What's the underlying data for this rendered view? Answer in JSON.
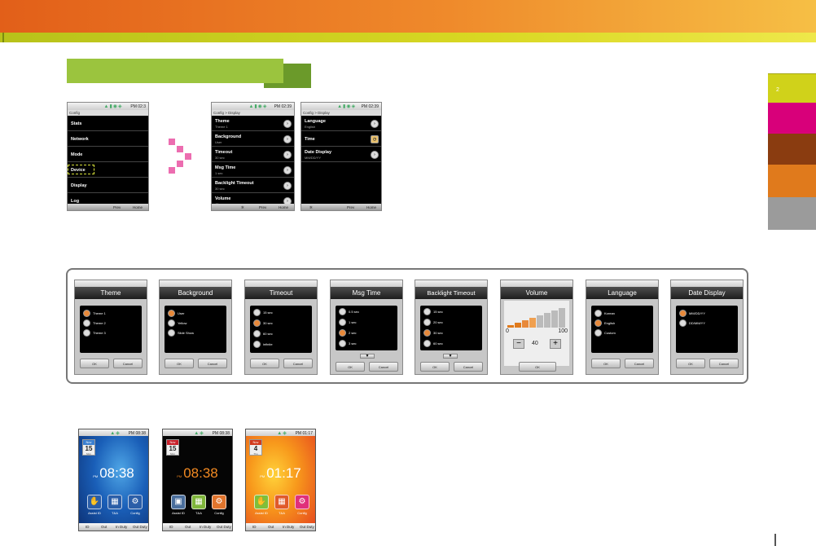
{
  "side_tab_label": "2",
  "colors": {
    "header_orange": "#e25f19",
    "header_yellow": "#d9d823",
    "section_green": "#9bc43e",
    "side_tabs": [
      "#d0d21a",
      "#d8007a",
      "#8a3c10",
      "#e07a1c",
      "#9b9b9b"
    ],
    "arrow_pink": "#ec6db0"
  },
  "phone_status_time": [
    "PM 02:3",
    "PM 02:39",
    "PM 02:39"
  ],
  "screen_config": {
    "crumb": "Config",
    "items": [
      "Stats",
      "Network",
      "Mode",
      "Device",
      "Display",
      "Log"
    ],
    "bottom": [
      "Prev",
      "Home"
    ]
  },
  "screen_display1": {
    "crumb": "Config > Display",
    "items": [
      {
        "label": "Theme",
        "sub": "Theme 1"
      },
      {
        "label": "Background",
        "sub": "User"
      },
      {
        "label": "Timeout",
        "sub": "30 sec"
      },
      {
        "label": "Msg Time",
        "sub": "1 sec"
      },
      {
        "label": "Backlight Timeout",
        "sub": "30 sec"
      },
      {
        "label": "Volume",
        "sub": "40"
      }
    ],
    "bottom": [
      "Prev",
      "Home"
    ]
  },
  "screen_display2": {
    "crumb": "Config > Display",
    "items": [
      {
        "label": "Language",
        "sub": "English"
      },
      {
        "label": "Time",
        "sub": ""
      },
      {
        "label": "Date Display",
        "sub": "MM/DD/YY"
      }
    ],
    "bottom": [
      "Prev",
      "Home"
    ]
  },
  "dialogs": [
    {
      "title": "Theme",
      "options": [
        "Theme 1",
        "Theme 2",
        "Theme 3"
      ],
      "selected": 0,
      "ok": "OK",
      "cancel": "Cancel"
    },
    {
      "title": "Background",
      "options": [
        "User",
        "Yellow",
        "Slide Show"
      ],
      "selected": 0,
      "ok": "OK",
      "cancel": "Cancel"
    },
    {
      "title": "Timeout",
      "options": [
        "15 sec",
        "30 sec",
        "60 sec",
        "infinite"
      ],
      "selected": 1,
      "ok": "OK",
      "cancel": "Cancel"
    },
    {
      "title": "Msg Time",
      "options": [
        "0.5 sec",
        "1 sec",
        "2 sec",
        "3 sec"
      ],
      "selected": 2,
      "ok": "OK",
      "cancel": "Cancel"
    },
    {
      "title": "Backlight Timeout",
      "options": [
        "15 sec",
        "20 sec",
        "30 sec",
        "60 sec"
      ],
      "selected": 2,
      "ok": "OK",
      "cancel": "Cancel"
    },
    {
      "title": "Volume",
      "min": "0",
      "max": "100",
      "value": "40",
      "ok": "OK"
    },
    {
      "title": "Language",
      "options": [
        "Korean",
        "English",
        "Custom"
      ],
      "selected": 1,
      "ok": "OK",
      "cancel": "Cancel"
    },
    {
      "title": "Date Display",
      "options": [
        "MM/DD/YY",
        "DD/MM/YY"
      ],
      "selected": 0,
      "ok": "OK",
      "cancel": "Cancel"
    }
  ],
  "home_screens": [
    {
      "status_time": "PM 08:38",
      "month": "Nov",
      "day": "15",
      "day_sub": "Mon",
      "ampm": "PM",
      "time": "08:38",
      "apps": [
        "Assist ID",
        "T&A",
        "Config"
      ],
      "bottom": [
        "ID",
        "Out",
        "In Duty",
        "Out Duty"
      ]
    },
    {
      "status_time": "PM 08:38",
      "month": "Nov",
      "day": "15",
      "day_sub": "Mon",
      "ampm": "PM",
      "time": "08:38",
      "apps": [
        "Assist ID",
        "T&A",
        "Config"
      ],
      "bottom": [
        "ID",
        "Out",
        "In Duty",
        "Out Duty"
      ]
    },
    {
      "status_time": "PM 01:17",
      "month": "Nov",
      "day": "4",
      "day_sub": "Thu",
      "ampm": "PM",
      "time": "01:17",
      "apps": [
        "Assist ID",
        "T&A",
        "Config"
      ],
      "bottom": [
        "ID",
        "Out",
        "In Duty",
        "Out Duty"
      ]
    }
  ]
}
